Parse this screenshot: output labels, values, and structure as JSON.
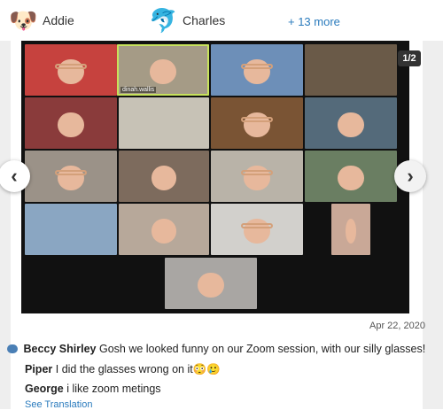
{
  "header": {
    "people": [
      {
        "emoji": "🐶",
        "name": "Addie"
      },
      {
        "emoji": "🐬",
        "name": "Charles"
      }
    ],
    "more_label": "+ 13 more"
  },
  "photo": {
    "counter": "1/2",
    "tile_label": "dinah.wallis",
    "prev_icon": "‹",
    "next_icon": "›"
  },
  "post": {
    "date": "Apr 22, 2020"
  },
  "comments": [
    {
      "author": "Beccy Shirley",
      "text": "Gosh we looked funny on our Zoom session, with our silly glasses!"
    },
    {
      "author": "Piper",
      "text": "I did the glasses wrong on it😳🥲"
    },
    {
      "author": "George",
      "text": "i like zoom metings"
    }
  ],
  "see_translation": "See Translation"
}
